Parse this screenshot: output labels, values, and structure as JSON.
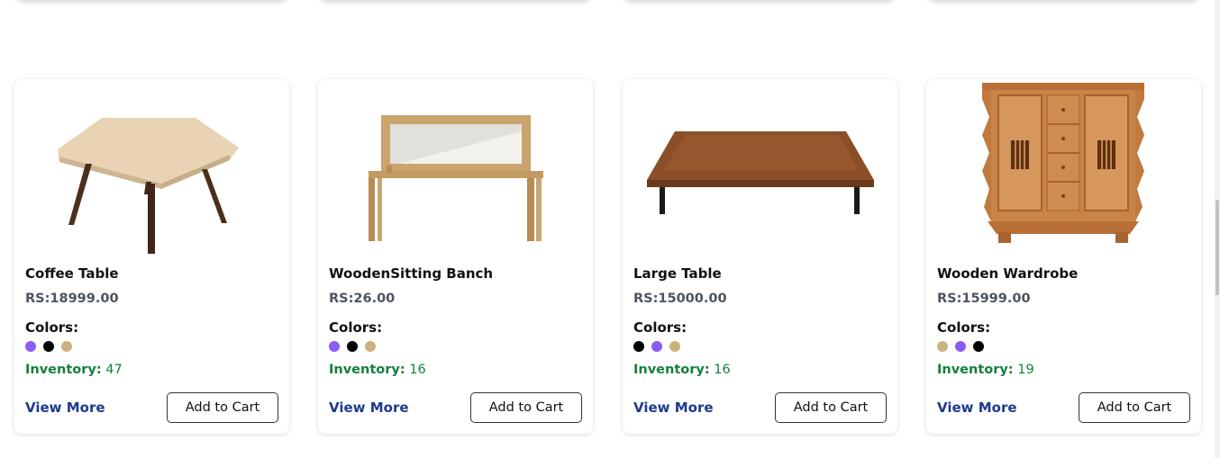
{
  "products": [
    {
      "name": "Coffee Table",
      "price": "RS:18999.00",
      "colors_label": "Colors:",
      "colors": [
        "#8b5cf6",
        "#000000",
        "#c9b27c"
      ],
      "inventory_label": "Inventory:",
      "inventory": "47",
      "view_more": "View More",
      "add_to_cart": "Add to Cart",
      "image_icon": "coffee-table-image"
    },
    {
      "name": "WoodenSitting Banch",
      "price": "RS:26.00",
      "colors_label": "Colors:",
      "colors": [
        "#8b5cf6",
        "#000000",
        "#c9b27c"
      ],
      "inventory_label": "Inventory:",
      "inventory": "16",
      "view_more": "View More",
      "add_to_cart": "Add to Cart",
      "image_icon": "wooden-bench-image"
    },
    {
      "name": "Large Table",
      "price": "RS:15000.00",
      "colors_label": "Colors:",
      "colors": [
        "#000000",
        "#8b5cf6",
        "#c9b27c"
      ],
      "inventory_label": "Inventory:",
      "inventory": "16",
      "view_more": "View More",
      "add_to_cart": "Add to Cart",
      "image_icon": "large-table-image"
    },
    {
      "name": "Wooden Wardrobe",
      "price": "RS:15999.00",
      "colors_label": "Colors:",
      "colors": [
        "#c9b27c",
        "#8b5cf6",
        "#000000"
      ],
      "inventory_label": "Inventory:",
      "inventory": "19",
      "view_more": "View More",
      "add_to_cart": "Add to Cart",
      "image_icon": "wooden-wardrobe-image"
    }
  ],
  "theme": {
    "inventory_color": "#15803d",
    "link_color": "#1e3a8a",
    "price_color": "#4b5563"
  }
}
